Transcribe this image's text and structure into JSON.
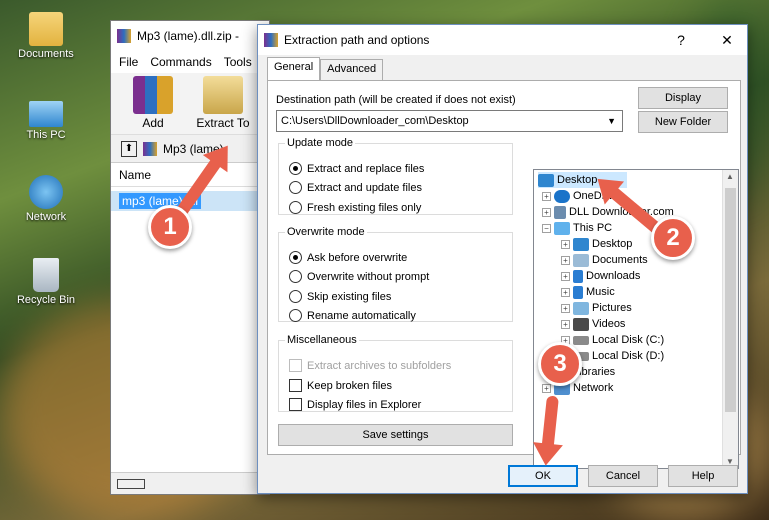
{
  "desktop": {
    "icons": [
      {
        "label": "Documents"
      },
      {
        "label": "This PC"
      },
      {
        "label": "Network"
      },
      {
        "label": "Recycle Bin"
      }
    ]
  },
  "winrar": {
    "title": "Mp3 (lame).dll.zip -",
    "menu": [
      "File",
      "Commands",
      "Tools"
    ],
    "toolbar": {
      "add": "Add",
      "extract_to": "Extract To"
    },
    "path": "Mp3 (lame)",
    "column_name": "Name",
    "file": "mp3 (lame).dll"
  },
  "dialog": {
    "title": "Extraction path and options",
    "help_btn": "?",
    "close_btn": "✕",
    "tabs": [
      "General",
      "Advanced"
    ],
    "dest_label": "Destination path (will be created if does not exist)",
    "dest_value": "C:\\Users\\DllDownloader_com\\Desktop",
    "display_btn": "Display",
    "new_folder_btn": "New Folder",
    "update_mode": {
      "legend": "Update mode",
      "options": [
        "Extract and replace files",
        "Extract and update files",
        "Fresh existing files only"
      ],
      "selected": 0
    },
    "overwrite_mode": {
      "legend": "Overwrite mode",
      "options": [
        "Ask before overwrite",
        "Overwrite without prompt",
        "Skip existing files",
        "Rename automatically"
      ],
      "selected": 0
    },
    "misc": {
      "legend": "Miscellaneous",
      "options": [
        "Extract archives to subfolders",
        "Keep broken files",
        "Display files in Explorer"
      ]
    },
    "save_settings": "Save settings",
    "tree": {
      "items": [
        "Desktop",
        "OneDrive",
        "DLL Downloader.com",
        "This PC",
        "Desktop",
        "Documents",
        "Downloads",
        "Music",
        "Pictures",
        "Videos",
        "Local Disk (C:)",
        "Local Disk (D:)",
        "Libraries",
        "Network"
      ]
    },
    "ok": "OK",
    "cancel": "Cancel",
    "help": "Help"
  },
  "annotations": {
    "step1": "1",
    "step2": "2",
    "step3": "3"
  },
  "colors": {
    "accent": "#0078d7",
    "annotation": "#e8604c",
    "selection": "#cce8ff"
  }
}
